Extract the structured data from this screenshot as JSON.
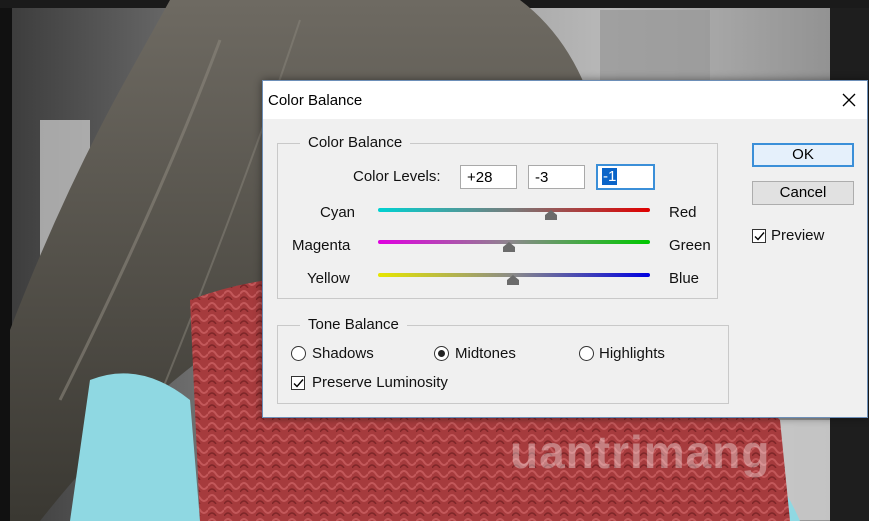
{
  "dialog": {
    "title": "Color Balance",
    "close_icon": "close-icon"
  },
  "color_balance": {
    "legend": "Color Balance",
    "levels_label": "Color Levels:",
    "levels": [
      "+28",
      "-3",
      "-1"
    ],
    "selected_field_index": 2,
    "sliders": [
      {
        "left": "Cyan",
        "right": "Red",
        "value": 28,
        "left_color": "#00d2d2",
        "right_color": "#e00000"
      },
      {
        "left": "Magenta",
        "right": "Green",
        "value": -3,
        "left_color": "#e000e0",
        "right_color": "#00c800"
      },
      {
        "left": "Yellow",
        "right": "Blue",
        "value": -1,
        "left_color": "#e6e600",
        "right_color": "#0000e0"
      }
    ],
    "slider_range": [
      -100,
      100
    ]
  },
  "tone_balance": {
    "legend": "Tone Balance",
    "options": [
      "Shadows",
      "Midtones",
      "Highlights"
    ],
    "selected": "Midtones",
    "preserve_luminosity_label": "Preserve Luminosity",
    "preserve_luminosity_checked": true
  },
  "buttons": {
    "ok": "OK",
    "cancel": "Cancel"
  },
  "preview": {
    "label": "Preview",
    "checked": true
  },
  "watermark": {
    "text": "uantrimang"
  },
  "colors": {
    "accent": "#3b8fd8",
    "dialog_bg": "#f0f0f0",
    "scarf_red": "#a83a3c",
    "jacket_cyan": "#8fd8e2"
  }
}
